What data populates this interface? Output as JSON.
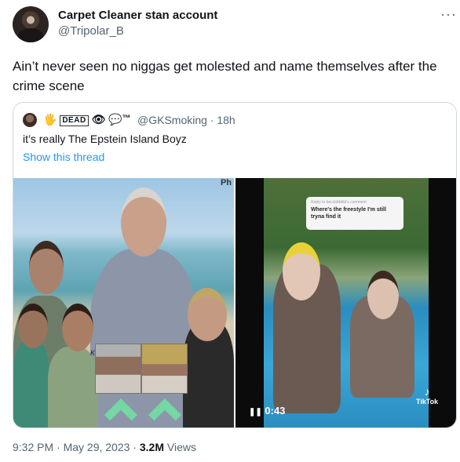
{
  "author": {
    "display_name": "Carpet Cleaner stan account",
    "handle": "@Tripolar_B"
  },
  "more_label": "···",
  "tweet_text": "Ain’t never seen no niggas get molested and name themselves after the crime scene",
  "quote": {
    "name_hand": "🖐",
    "name_box": "DEAD",
    "name_eye": "👁",
    "name_bubble": "💬",
    "name_tm": "™",
    "meta": "@GKSmoking · 18h",
    "text": "it’s really The Epstein Island Boyz",
    "show_thread": "Show this thread",
    "left_image_label": "Ph",
    "left_image_caption": "Kotari",
    "reply_small": "Reply to beccbbbbbl's comment",
    "reply_text": "Where's the freestyle I'm still tryna find it",
    "video_time": "0:43",
    "video_pause_icon": "❚❚",
    "tiktok_label": "TikTok"
  },
  "footer": {
    "time": "9:32 PM · May 29, 2023 · ",
    "views_count": "3.2M",
    "views_label": " Views"
  }
}
